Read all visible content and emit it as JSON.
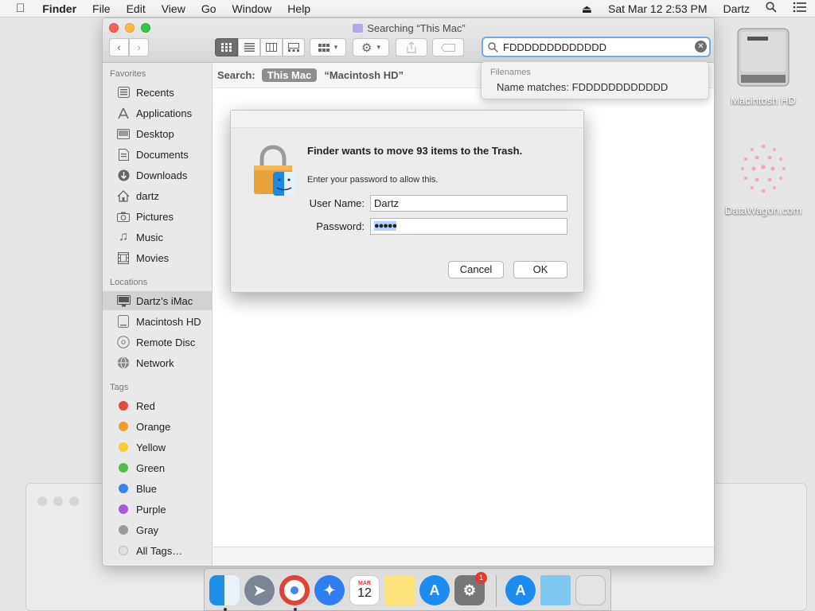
{
  "menubar": {
    "app": "Finder",
    "items": [
      "File",
      "Edit",
      "View",
      "Go",
      "Window",
      "Help"
    ],
    "datetime": "Sat Mar 12  2:53 PM",
    "user": "Dartz"
  },
  "desktop": {
    "icons": [
      {
        "label": "Macintosh HD",
        "icon": "hard-drive-icon"
      },
      {
        "label": "DataWagon.com",
        "icon": "dotted-sphere-icon"
      }
    ]
  },
  "finder": {
    "title": "Searching “This Mac”",
    "search_value": "FDDDDDDDDDDDDD",
    "scope": {
      "label": "Search:",
      "this_mac": "This Mac",
      "hd": "“Macintosh HD”"
    },
    "suggestions": {
      "header": "Filenames",
      "row": "Name matches: FDDDDDDDDDDDD"
    },
    "sidebar": {
      "favorites_header": "Favorites",
      "favorites": [
        {
          "label": "Recents",
          "icon": "recents-icon"
        },
        {
          "label": "Applications",
          "icon": "applications-icon"
        },
        {
          "label": "Desktop",
          "icon": "desktop-icon"
        },
        {
          "label": "Documents",
          "icon": "documents-icon"
        },
        {
          "label": "Downloads",
          "icon": "downloads-icon"
        },
        {
          "label": "dartz",
          "icon": "home-icon"
        },
        {
          "label": "Pictures",
          "icon": "camera-icon"
        },
        {
          "label": "Music",
          "icon": "music-icon"
        },
        {
          "label": "Movies",
          "icon": "film-icon"
        }
      ],
      "locations_header": "Locations",
      "locations": [
        {
          "label": "Dartz’s iMac",
          "icon": "imac-icon",
          "selected": true
        },
        {
          "label": "Macintosh HD",
          "icon": "disk-icon"
        },
        {
          "label": "Remote Disc",
          "icon": "disc-icon"
        },
        {
          "label": "Network",
          "icon": "globe-icon"
        }
      ],
      "tags_header": "Tags",
      "tags": [
        {
          "label": "Red",
          "color": "#e8463f"
        },
        {
          "label": "Orange",
          "color": "#f39a2b"
        },
        {
          "label": "Yellow",
          "color": "#f7cd2e"
        },
        {
          "label": "Green",
          "color": "#4cbf4a"
        },
        {
          "label": "Blue",
          "color": "#3a82f0"
        },
        {
          "label": "Purple",
          "color": "#a55bd1"
        },
        {
          "label": "Gray",
          "color": "#9a9a9a"
        },
        {
          "label": "All Tags…",
          "color": "#e0e0e0"
        }
      ]
    }
  },
  "dialog": {
    "message": "Finder wants to move 93 items to the Trash.",
    "sub": "Enter your password to allow this.",
    "username_label": "User Name:",
    "username_value": "Dartz",
    "password_label": "Password:",
    "password_value": "●●●●●",
    "cancel": "Cancel",
    "ok": "OK"
  },
  "dock": {
    "apps": [
      "Finder",
      "Launchpad",
      "Chrome",
      "Safari",
      "Calendar",
      "Notes",
      "App Store",
      "System Preferences",
      "App Store",
      "Downloads",
      "Trash"
    ],
    "calendar_month": "MAR",
    "calendar_day": "12",
    "badge": "1"
  }
}
